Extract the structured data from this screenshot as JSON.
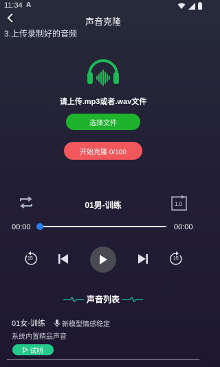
{
  "status_bar": {
    "time": "11:34",
    "app_icon": "A"
  },
  "header": {
    "title": "声音克隆",
    "back_icon": "back-arrow"
  },
  "step_label": "3.上传录制好的音频",
  "upload": {
    "hint": "请上传.mp3或者.wav文件",
    "select_label": "选择文件",
    "start_label": "开始克隆 0/100"
  },
  "player": {
    "track_name": "01男-训练",
    "speed_label": "1.0",
    "current_time": "00:00",
    "total_time": "00:00",
    "progress": 0,
    "skip_back_label": "15",
    "skip_forward_label": "15"
  },
  "voice_list": {
    "title": "声音列表",
    "items": [
      {
        "name": "01女-训练",
        "tag": "新模型情感稳定",
        "desc": "系统内置精品声音",
        "try_label": "试听"
      }
    ]
  },
  "colors": {
    "accent_green": "#1fb32d",
    "start_red": "#f2575b",
    "thumb_blue": "#2a7ff3",
    "try_green": "#25c98a",
    "logo_green": "#1db954"
  }
}
